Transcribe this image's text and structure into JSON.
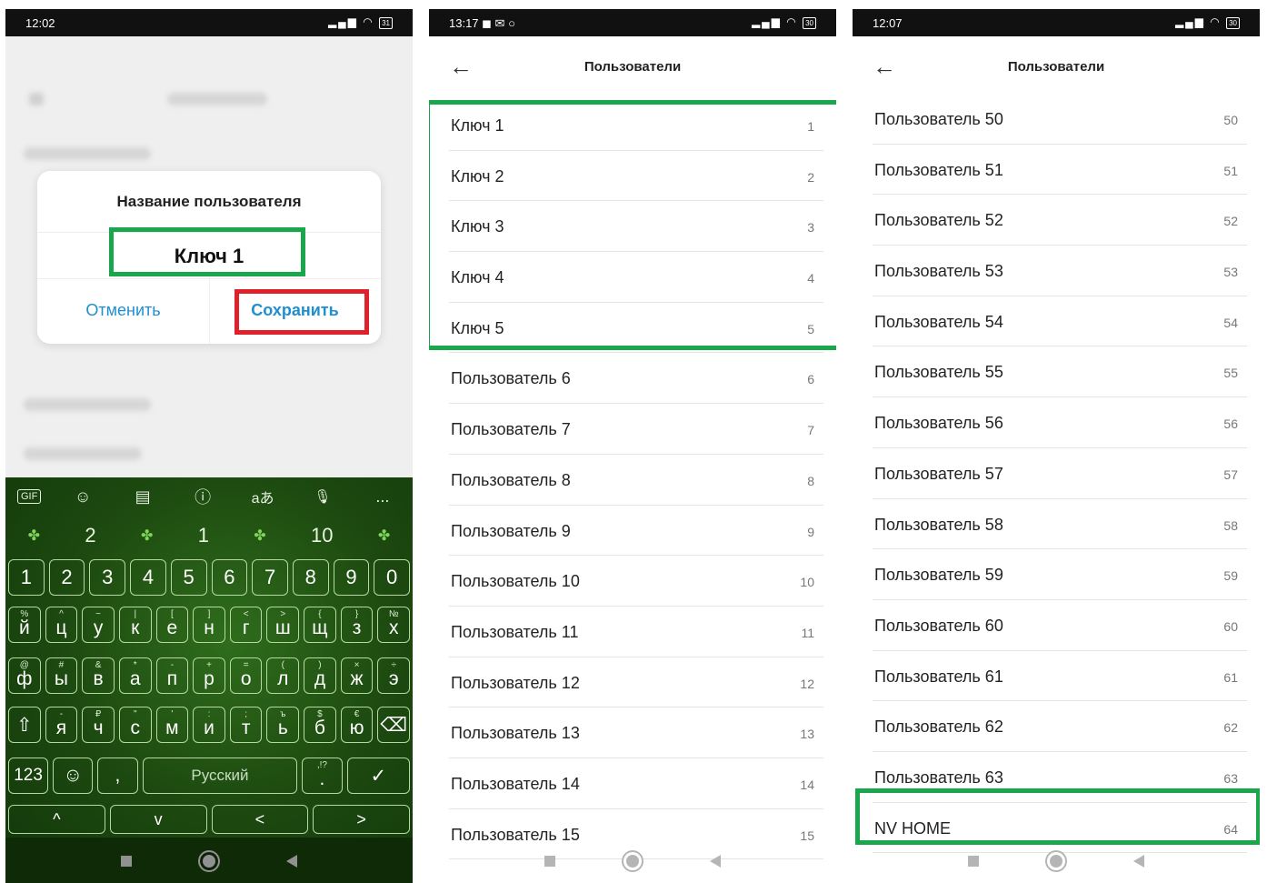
{
  "panel1": {
    "status": {
      "time": "12:02",
      "battery": "31"
    },
    "dialog": {
      "title": "Название пользователя",
      "value": "Ключ 1",
      "cancel": "Отменить",
      "save": "Сохранить"
    },
    "keyboard": {
      "toolbar": [
        "GIF",
        "☺",
        "▤",
        "ⓘ",
        "aあ",
        "🎙",
        "..."
      ],
      "suggestions": [
        "2",
        "1",
        "10"
      ],
      "row_numbers": [
        "1",
        "2",
        "3",
        "4",
        "5",
        "6",
        "7",
        "8",
        "9",
        "0"
      ],
      "row1": [
        [
          "й",
          "%"
        ],
        [
          "ц",
          "^"
        ],
        [
          "у",
          "~"
        ],
        [
          "к",
          "|"
        ],
        [
          "е",
          "["
        ],
        [
          "н",
          "]"
        ],
        [
          "г",
          "<"
        ],
        [
          "ш",
          ">"
        ],
        [
          "щ",
          "{"
        ],
        [
          "з",
          "}"
        ],
        [
          "х",
          "№"
        ]
      ],
      "row2": [
        [
          "ф",
          "@"
        ],
        [
          "ы",
          "#"
        ],
        [
          "в",
          "&"
        ],
        [
          "а",
          "*"
        ],
        [
          "п",
          "-"
        ],
        [
          "р",
          "+"
        ],
        [
          "о",
          "="
        ],
        [
          "л",
          "("
        ],
        [
          "д",
          ")"
        ],
        [
          "ж",
          "×"
        ],
        [
          "э",
          "÷"
        ]
      ],
      "row3": [
        [
          "я",
          "-"
        ],
        [
          "ч",
          "₽"
        ],
        [
          "с",
          "\""
        ],
        [
          "м",
          "'"
        ],
        [
          "и",
          ":"
        ],
        [
          "т",
          ";"
        ],
        [
          "ь",
          "ъ"
        ],
        [
          "б",
          "$"
        ],
        [
          "ю",
          "€"
        ]
      ],
      "row4": {
        "numbers": "123",
        "comma": ",",
        "space": "Русский",
        "period": ".",
        "period_alt": ",!?"
      },
      "row5": [
        "^",
        "v",
        "<",
        ">"
      ]
    }
  },
  "panel2": {
    "status": {
      "time": "13:17",
      "battery": "30"
    },
    "title": "Пользователи",
    "rows": [
      {
        "name": "Ключ 1",
        "num": "1"
      },
      {
        "name": "Ключ 2",
        "num": "2"
      },
      {
        "name": "Ключ 3",
        "num": "3"
      },
      {
        "name": "Ключ 4",
        "num": "4"
      },
      {
        "name": "Ключ 5",
        "num": "5"
      },
      {
        "name": "Пользователь 6",
        "num": "6"
      },
      {
        "name": "Пользователь 7",
        "num": "7"
      },
      {
        "name": "Пользователь 8",
        "num": "8"
      },
      {
        "name": "Пользователь 9",
        "num": "9"
      },
      {
        "name": "Пользователь 10",
        "num": "10"
      },
      {
        "name": "Пользователь 11",
        "num": "11"
      },
      {
        "name": "Пользователь 12",
        "num": "12"
      },
      {
        "name": "Пользователь 13",
        "num": "13"
      },
      {
        "name": "Пользователь 14",
        "num": "14"
      },
      {
        "name": "Пользователь 15",
        "num": "15"
      }
    ]
  },
  "panel3": {
    "status": {
      "time": "12:07",
      "battery": "30"
    },
    "title": "Пользователи",
    "rows": [
      {
        "name": "Пользователь 50",
        "num": "50"
      },
      {
        "name": "Пользователь 51",
        "num": "51"
      },
      {
        "name": "Пользователь 52",
        "num": "52"
      },
      {
        "name": "Пользователь 53",
        "num": "53"
      },
      {
        "name": "Пользователь 54",
        "num": "54"
      },
      {
        "name": "Пользователь 55",
        "num": "55"
      },
      {
        "name": "Пользователь 56",
        "num": "56"
      },
      {
        "name": "Пользователь 57",
        "num": "57"
      },
      {
        "name": "Пользователь 58",
        "num": "58"
      },
      {
        "name": "Пользователь 59",
        "num": "59"
      },
      {
        "name": "Пользователь 60",
        "num": "60"
      },
      {
        "name": "Пользователь 61",
        "num": "61"
      },
      {
        "name": "Пользователь 62",
        "num": "62"
      },
      {
        "name": "Пользователь 63",
        "num": "63"
      },
      {
        "name": "NV HOME",
        "num": "64"
      }
    ]
  },
  "colors": {
    "highlight_green": "#1aa64b",
    "highlight_red": "#e0212b",
    "link_blue": "#1e8fd1"
  }
}
